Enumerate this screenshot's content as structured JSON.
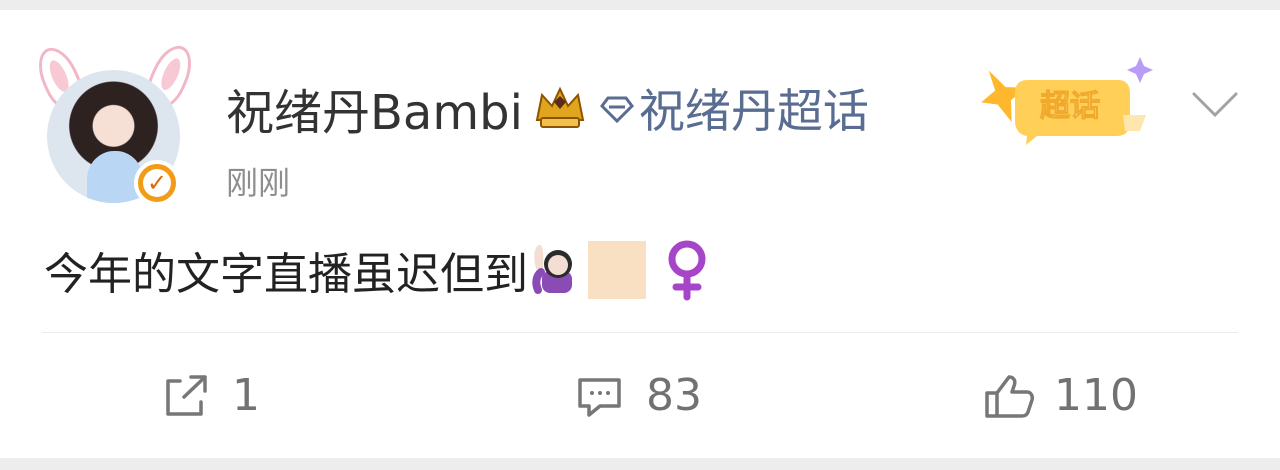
{
  "post": {
    "username": "祝绪丹Bambi",
    "topic": "祝绪丹超话",
    "super_topic_badge": "超话",
    "timestamp": "刚刚",
    "content": "今年的文字直播虽迟但到",
    "content_emojis": [
      "woman-raising-hand-icon",
      "skin-tone-block",
      "female-symbol-icon"
    ]
  },
  "actions": {
    "repost_count": "1",
    "comment_count": "83",
    "like_count": "110"
  },
  "colors": {
    "topic": "#596c91",
    "accent": "#f29b16",
    "divider": "#ececec",
    "text": "#333333"
  }
}
